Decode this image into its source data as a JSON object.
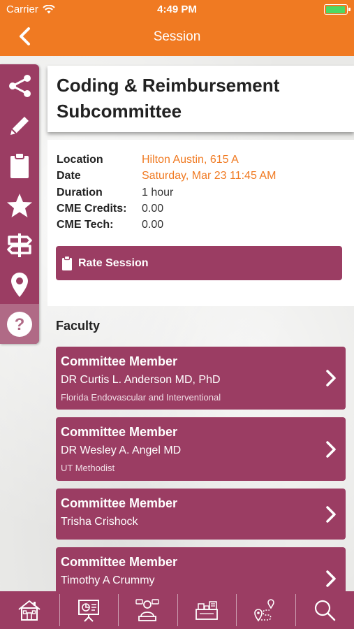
{
  "status_bar": {
    "carrier": "Carrier",
    "time": "4:49 PM"
  },
  "nav": {
    "title": "Session",
    "back_icon": "chevron-left-icon"
  },
  "sidebar": {
    "items": [
      {
        "icon": "share-icon"
      },
      {
        "icon": "pencil-icon"
      },
      {
        "icon": "clipboard-icon"
      },
      {
        "icon": "star-icon"
      },
      {
        "icon": "signpost-icon"
      },
      {
        "icon": "location-pin-icon"
      },
      {
        "icon": "help-icon",
        "active": true
      }
    ]
  },
  "session": {
    "title_line1": "Coding & Reimbursement",
    "title_line2": "Subcommittee",
    "details": [
      {
        "label": "Location",
        "value": "Hilton Austin, 615 A"
      },
      {
        "label": "Date",
        "value": "Saturday, Mar 23 11:45 AM"
      },
      {
        "label": "Duration",
        "value": "1 hour"
      },
      {
        "label": "CME Credits:",
        "value": "0.00"
      },
      {
        "label": "CME Tech:",
        "value": "0.00"
      }
    ],
    "rate_button": "Rate Session"
  },
  "faculty": {
    "heading": "Faculty",
    "members": [
      {
        "role": "Committee Member",
        "name": "DR Curtis L. Anderson MD, PhD",
        "org": "Florida Endovascular and Interventional"
      },
      {
        "role": "Committee Member",
        "name": "DR Wesley A. Angel MD",
        "org": "UT Methodist"
      },
      {
        "role": "Committee Member",
        "name": "Trisha Crishock",
        "org": ""
      },
      {
        "role": "Committee Member",
        "name": "Timothy A Crummy",
        "org": ""
      }
    ]
  },
  "tabbar": {
    "items": [
      {
        "icon": "home-icon"
      },
      {
        "icon": "presentation-icon"
      },
      {
        "icon": "speakers-icon"
      },
      {
        "icon": "exhibits-icon"
      },
      {
        "icon": "map-route-icon"
      },
      {
        "icon": "search-icon"
      }
    ]
  },
  "colors": {
    "accent": "#f07a22",
    "primary": "#9b3d63",
    "battery": "#4cd964"
  }
}
